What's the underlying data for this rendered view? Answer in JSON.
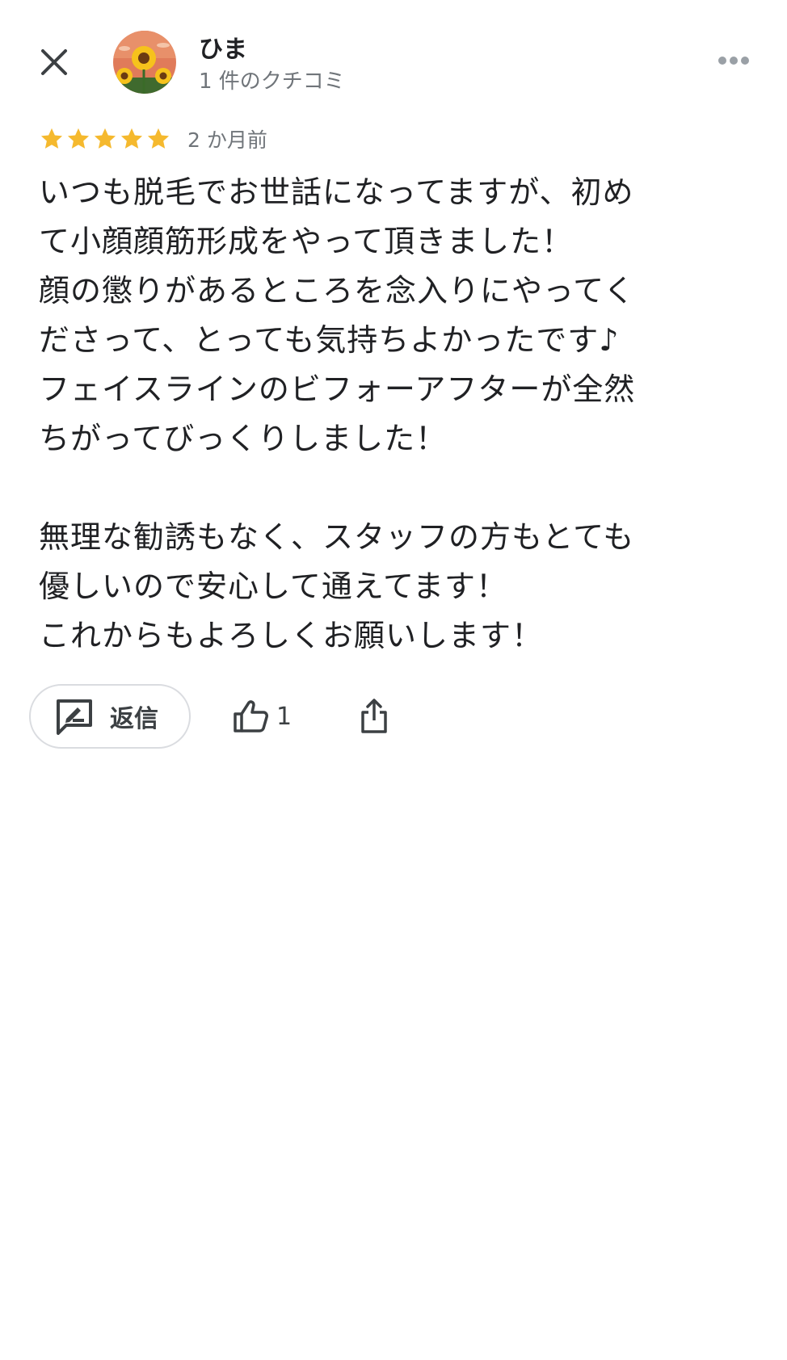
{
  "author": {
    "name": "ひま",
    "meta": "1 件のクチコミ"
  },
  "review": {
    "rating": 5,
    "rating_max": 5,
    "date": "2 か月前",
    "text": "いつも脱毛でお世話になってますが、初め\nて小顔顔筋形成をやって頂きました！\n顔の懲りがあるところを念入りにやってく\nださって、とっても気持ちよかったです♪\nフェイスラインのビフォーアフターが全然\nちがってびっくりしました！\n\n無理な勧誘もなく、スタッフの方もとても\n優しいので安心して通えてます！\nこれからもよろしくお願いします！"
  },
  "actions": {
    "reply_label": "返信",
    "like_count": "1"
  },
  "colors": {
    "star": "#f5b92e",
    "secondary_text": "#70757a",
    "border": "#dadce0",
    "icon": "#3c4043"
  },
  "icons": {
    "close": "close-icon",
    "more": "more-horizontal-icon",
    "star": "star-icon",
    "reply": "reply-icon",
    "like": "thumb-up-icon",
    "share": "share-icon"
  }
}
